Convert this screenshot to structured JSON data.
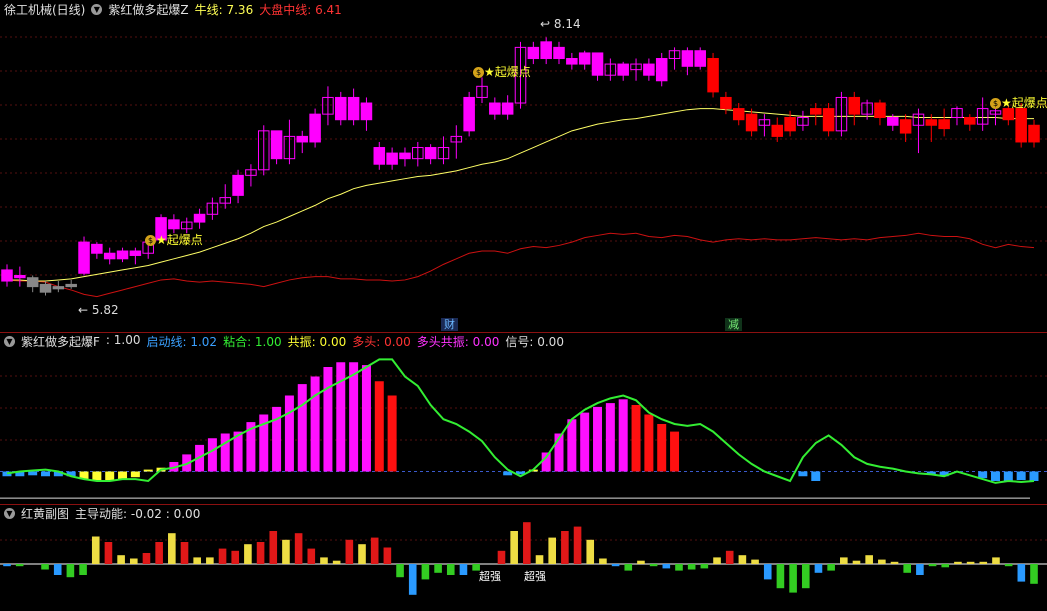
{
  "main": {
    "stock_title": "徐工机械(日线)",
    "indicator_name": "紫红做多起爆Z",
    "bull_label": "牛线",
    "bull_value": "7.36",
    "market_label": "大盘中线",
    "market_value": "6.41",
    "high_price": "8.14",
    "low_price": "5.82",
    "signal_text": "起爆点",
    "marker_cai": "财",
    "marker_jian": "减",
    "colors": {
      "up": "#ff00ff",
      "down": "#ff0000",
      "bull": "#ffff66",
      "market": "#cc1111",
      "gray": "#888888"
    }
  },
  "panel2": {
    "name": "紫红做多起爆F",
    "items": [
      {
        "label": "",
        "value": ": 1.00",
        "color": "#dddddd"
      },
      {
        "label": "启动线",
        "value": ": 1.02",
        "color": "#3aa0ff"
      },
      {
        "label": "粘合",
        "value": ": 1.00",
        "color": "#33ee33"
      },
      {
        "label": "共振",
        "value": ": 0.00",
        "color": "#ffff33"
      },
      {
        "label": "多头",
        "value": ": 0.00",
        "color": "#ff3333"
      },
      {
        "label": "多头共振",
        "value": ": 0.00",
        "color": "#ff33ff"
      },
      {
        "label": "信号",
        "value": ": 0.00",
        "color": "#dddddd"
      }
    ]
  },
  "panel3": {
    "name": "红黄副图",
    "main_label": "主导动能",
    "values": ": -0.02 : 0.00",
    "strong_label": "超强"
  },
  "chart_data": [
    {
      "type": "candlestick",
      "title": "紫红做多起爆Z",
      "high": 8.14,
      "low": 5.82,
      "ylim": [
        5.6,
        8.35
      ],
      "candles": [
        [
          5.95,
          6.05,
          5.9,
          6.1
        ],
        [
          6.0,
          5.98,
          5.9,
          6.08
        ],
        [
          5.98,
          5.9,
          5.85,
          6.0
        ],
        [
          5.92,
          5.85,
          5.82,
          5.95
        ],
        [
          5.88,
          5.9,
          5.85,
          5.95
        ],
        [
          5.9,
          5.92,
          5.88,
          5.96
        ],
        [
          6.02,
          6.3,
          6.0,
          6.35
        ],
        [
          6.28,
          6.2,
          6.15,
          6.3
        ],
        [
          6.2,
          6.15,
          6.1,
          6.25
        ],
        [
          6.15,
          6.22,
          6.12,
          6.25
        ],
        [
          6.22,
          6.18,
          6.1,
          6.25
        ],
        [
          6.2,
          6.3,
          6.15,
          6.33
        ],
        [
          6.32,
          6.52,
          6.3,
          6.55
        ],
        [
          6.5,
          6.42,
          6.38,
          6.55
        ],
        [
          6.42,
          6.48,
          6.38,
          6.52
        ],
        [
          6.48,
          6.55,
          6.42,
          6.6
        ],
        [
          6.55,
          6.65,
          6.5,
          6.7
        ],
        [
          6.65,
          6.7,
          6.6,
          6.82
        ],
        [
          6.72,
          6.9,
          6.65,
          6.95
        ],
        [
          6.9,
          6.95,
          6.8,
          7.0
        ],
        [
          6.95,
          7.3,
          6.9,
          7.35
        ],
        [
          7.3,
          7.05,
          7.0,
          7.3
        ],
        [
          7.05,
          7.25,
          7.0,
          7.4
        ],
        [
          7.25,
          7.2,
          7.1,
          7.3
        ],
        [
          7.2,
          7.45,
          7.15,
          7.5
        ],
        [
          7.45,
          7.6,
          7.35,
          7.7
        ],
        [
          7.6,
          7.4,
          7.35,
          7.65
        ],
        [
          7.4,
          7.6,
          7.35,
          7.68
        ],
        [
          7.55,
          7.4,
          7.3,
          7.6
        ],
        [
          7.15,
          7.0,
          6.95,
          7.2
        ],
        [
          7.0,
          7.1,
          6.95,
          7.15
        ],
        [
          7.1,
          7.05,
          6.98,
          7.15
        ],
        [
          7.05,
          7.15,
          6.98,
          7.2
        ],
        [
          7.15,
          7.05,
          7.0,
          7.18
        ],
        [
          7.05,
          7.15,
          7.0,
          7.25
        ],
        [
          7.2,
          7.25,
          7.05,
          7.35
        ],
        [
          7.3,
          7.6,
          7.25,
          7.65
        ],
        [
          7.6,
          7.7,
          7.55,
          7.78
        ],
        [
          7.55,
          7.45,
          7.4,
          7.6
        ],
        [
          7.45,
          7.55,
          7.4,
          7.62
        ],
        [
          7.55,
          8.05,
          7.5,
          8.1
        ],
        [
          8.05,
          7.95,
          7.9,
          8.1
        ],
        [
          7.95,
          8.1,
          7.9,
          8.14
        ],
        [
          8.05,
          7.95,
          7.9,
          8.1
        ],
        [
          7.95,
          7.9,
          7.85,
          8.0
        ],
        [
          7.9,
          8.0,
          7.85,
          8.02
        ],
        [
          8.0,
          7.8,
          7.75,
          8.0
        ],
        [
          7.8,
          7.9,
          7.75,
          7.95
        ],
        [
          7.9,
          7.8,
          7.75,
          7.92
        ],
        [
          7.85,
          7.9,
          7.75,
          7.95
        ],
        [
          7.9,
          7.8,
          7.75,
          7.95
        ],
        [
          7.75,
          7.95,
          7.7,
          8.0
        ],
        [
          7.95,
          8.02,
          7.85,
          8.05
        ],
        [
          8.02,
          7.88,
          7.8,
          8.05
        ],
        [
          7.88,
          8.02,
          7.85,
          8.05
        ],
        [
          7.95,
          7.65,
          7.6,
          8.0
        ],
        [
          7.6,
          7.5,
          7.45,
          7.65
        ],
        [
          7.5,
          7.4,
          7.35,
          7.55
        ],
        [
          7.45,
          7.3,
          7.25,
          7.5
        ],
        [
          7.35,
          7.4,
          7.25,
          7.45
        ],
        [
          7.35,
          7.25,
          7.2,
          7.42
        ],
        [
          7.42,
          7.3,
          7.25,
          7.48
        ],
        [
          7.35,
          7.42,
          7.3,
          7.48
        ],
        [
          7.5,
          7.45,
          7.35,
          7.55
        ],
        [
          7.5,
          7.3,
          7.25,
          7.55
        ],
        [
          7.3,
          7.6,
          7.25,
          7.65
        ],
        [
          7.6,
          7.45,
          7.35,
          7.65
        ],
        [
          7.45,
          7.55,
          7.4,
          7.58
        ],
        [
          7.55,
          7.42,
          7.35,
          7.58
        ],
        [
          7.35,
          7.42,
          7.3,
          7.45
        ],
        [
          7.4,
          7.28,
          7.2,
          7.45
        ],
        [
          7.35,
          7.45,
          7.1,
          7.5
        ],
        [
          7.4,
          7.35,
          7.2,
          7.45
        ],
        [
          7.4,
          7.32,
          7.25,
          7.5
        ],
        [
          7.42,
          7.5,
          7.35,
          7.52
        ],
        [
          7.42,
          7.36,
          7.3,
          7.45
        ],
        [
          7.36,
          7.5,
          7.3,
          7.6
        ],
        [
          7.45,
          7.48,
          7.35,
          7.55
        ],
        [
          7.5,
          7.4,
          7.35,
          7.52
        ],
        [
          7.5,
          7.2,
          7.15,
          7.55
        ],
        [
          7.35,
          7.2,
          7.15,
          7.4
        ]
      ],
      "bull_line": [
        5.96,
        5.96,
        5.95,
        5.95,
        5.96,
        5.97,
        5.99,
        6.01,
        6.03,
        6.05,
        6.07,
        6.09,
        6.12,
        6.15,
        6.18,
        6.21,
        6.25,
        6.29,
        6.33,
        6.38,
        6.44,
        6.48,
        6.53,
        6.58,
        6.63,
        6.69,
        6.73,
        6.78,
        6.81,
        6.83,
        6.85,
        6.87,
        6.89,
        6.9,
        6.92,
        6.94,
        6.97,
        7.0,
        7.02,
        7.05,
        7.1,
        7.15,
        7.2,
        7.25,
        7.3,
        7.33,
        7.36,
        7.38,
        7.4,
        7.41,
        7.43,
        7.45,
        7.47,
        7.49,
        7.5,
        7.5,
        7.49,
        7.48,
        7.47,
        7.46,
        7.45,
        7.44,
        7.43,
        7.43,
        7.43,
        7.43,
        7.43,
        7.43,
        7.43,
        7.43,
        7.43,
        7.42,
        7.42,
        7.42,
        7.42,
        7.42,
        7.42,
        7.42,
        7.41,
        7.41,
        7.41
      ],
      "market_line": [
        5.96,
        5.95,
        5.95,
        5.94,
        5.9,
        5.87,
        5.83,
        5.81,
        5.84,
        5.87,
        5.9,
        5.93,
        5.96,
        5.97,
        5.95,
        5.94,
        5.95,
        5.94,
        5.93,
        5.92,
        5.9,
        5.93,
        5.96,
        5.98,
        5.99,
        5.99,
        5.97,
        5.97,
        5.96,
        5.96,
        5.95,
        5.96,
        5.99,
        6.04,
        6.1,
        6.15,
        6.2,
        6.22,
        6.22,
        6.2,
        6.24,
        6.26,
        6.25,
        6.27,
        6.3,
        6.34,
        6.36,
        6.38,
        6.37,
        6.38,
        6.35,
        6.34,
        6.36,
        6.35,
        6.32,
        6.3,
        6.32,
        6.33,
        6.32,
        6.33,
        6.32,
        6.32,
        6.33,
        6.34,
        6.33,
        6.32,
        6.33,
        6.32,
        6.34,
        6.35,
        6.36,
        6.38,
        6.36,
        6.35,
        6.35,
        6.33,
        6.28,
        6.25,
        6.28,
        6.26,
        6.25
      ],
      "signal_points": [
        10,
        32,
        74
      ],
      "grid": true
    },
    {
      "type": "bar+line",
      "title": "紫红做多起爆F",
      "ylim": [
        -0.3,
        1.3
      ],
      "baseline": 0,
      "line": [
        -0.02,
        0.0,
        0.01,
        0.02,
        0.0,
        -0.05,
        -0.08,
        -0.1,
        -0.1,
        -0.08,
        -0.08,
        -0.1,
        0.02,
        0.04,
        0.08,
        0.15,
        0.22,
        0.3,
        0.38,
        0.45,
        0.5,
        0.55,
        0.62,
        0.7,
        0.8,
        0.88,
        0.95,
        1.02,
        1.1,
        1.18,
        1.18,
        1.0,
        0.9,
        0.7,
        0.55,
        0.5,
        0.42,
        0.32,
        0.15,
        0.02,
        -0.05,
        0.02,
        0.15,
        0.35,
        0.55,
        0.65,
        0.72,
        0.77,
        0.8,
        0.75,
        0.62,
        0.55,
        0.5,
        0.48,
        0.5,
        0.42,
        0.3,
        0.18,
        0.08,
        0.0,
        -0.05,
        -0.1,
        0.15,
        0.3,
        0.38,
        0.28,
        0.15,
        0.08,
        0.05,
        0.03,
        0.0,
        -0.02,
        -0.03,
        -0.05,
        0.0,
        -0.04,
        -0.08,
        -0.12,
        -0.1,
        -0.11,
        -0.1
      ],
      "bars": [
        -0.05,
        -0.05,
        -0.04,
        -0.05,
        -0.05,
        -0.05,
        -0.08,
        -0.1,
        -0.1,
        -0.08,
        -0.06,
        0.02,
        0.04,
        0.1,
        0.18,
        0.28,
        0.35,
        0.4,
        0.42,
        0.52,
        0.6,
        0.68,
        0.8,
        0.92,
        1.0,
        1.1,
        1.15,
        1.15,
        1.12,
        0.95,
        0.8,
        0,
        0,
        0,
        0,
        0,
        0,
        0,
        0,
        -0.04,
        -0.03,
        0.02,
        0.2,
        0.4,
        0.55,
        0.62,
        0.68,
        0.72,
        0.76,
        0.7,
        0.6,
        0.5,
        0.42,
        0,
        0,
        0,
        0,
        0,
        0,
        0,
        0,
        0,
        -0.05,
        -0.1,
        0,
        0,
        0,
        0,
        0,
        0,
        0,
        0,
        -0.03,
        -0.05,
        0,
        0,
        -0.07,
        -0.1,
        -0.1,
        -0.09,
        -0.1
      ]
    },
    {
      "type": "bar",
      "title": "红黄副图",
      "ylim": [
        -0.4,
        0.4
      ],
      "values": [
        -0.02,
        -0.02,
        0.0,
        -0.05,
        -0.1,
        -0.12,
        -0.1,
        0.25,
        0.2,
        0.08,
        0.05,
        0.1,
        0.2,
        0.28,
        0.2,
        0.06,
        0.06,
        0.14,
        0.12,
        0.18,
        0.2,
        0.3,
        0.22,
        0.28,
        0.14,
        0.06,
        0.03,
        0.22,
        0.18,
        0.24,
        0.15,
        -0.12,
        -0.28,
        -0.14,
        -0.08,
        -0.1,
        -0.1,
        -0.06,
        0.0,
        0.12,
        0.3,
        0.38,
        0.08,
        0.24,
        0.3,
        0.34,
        0.22,
        0.05,
        -0.02,
        -0.06,
        0.03,
        -0.02,
        -0.04,
        -0.06,
        -0.05,
        -0.04,
        0.06,
        0.12,
        0.08,
        0.04,
        -0.14,
        -0.22,
        -0.26,
        -0.22,
        -0.08,
        -0.06,
        0.06,
        0.03,
        0.08,
        0.04,
        0.02,
        -0.08,
        -0.1,
        -0.02,
        -0.03,
        0.02,
        0.02,
        0.02,
        0.06,
        -0.02,
        -0.16,
        -0.18
      ]
    }
  ]
}
